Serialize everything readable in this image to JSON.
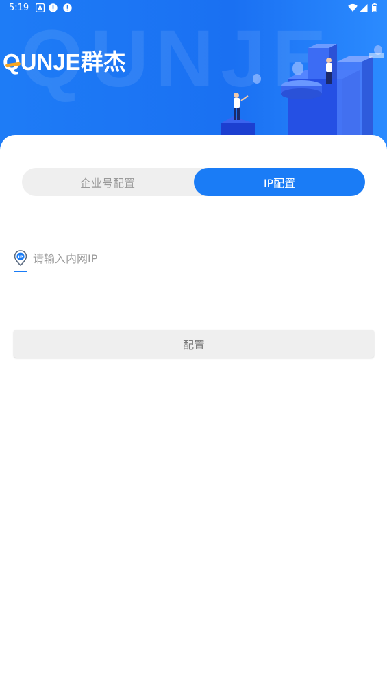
{
  "status_bar": {
    "time": "5:19",
    "left_icons": [
      "a-letter-icon",
      "alert-circle-icon",
      "alert-circle-icon"
    ],
    "right_icons": [
      "wifi-icon",
      "cellular-signal-icon",
      "battery-icon"
    ]
  },
  "hero": {
    "watermark": "QUNJE",
    "logo_latin": "QUNJE",
    "logo_cjk": "群杰",
    "colors": {
      "primary": "#1a7cf6",
      "bg_start": "#1e7cf6",
      "bg_end": "#2b8bff"
    }
  },
  "tabs": [
    {
      "label": "企业号配置",
      "active": false
    },
    {
      "label": "IP配置",
      "active": true
    }
  ],
  "ip_field": {
    "icon": "ip-location-pin-icon",
    "value": "",
    "placeholder": "请输入内网IP"
  },
  "config_button": {
    "label": "配置"
  }
}
